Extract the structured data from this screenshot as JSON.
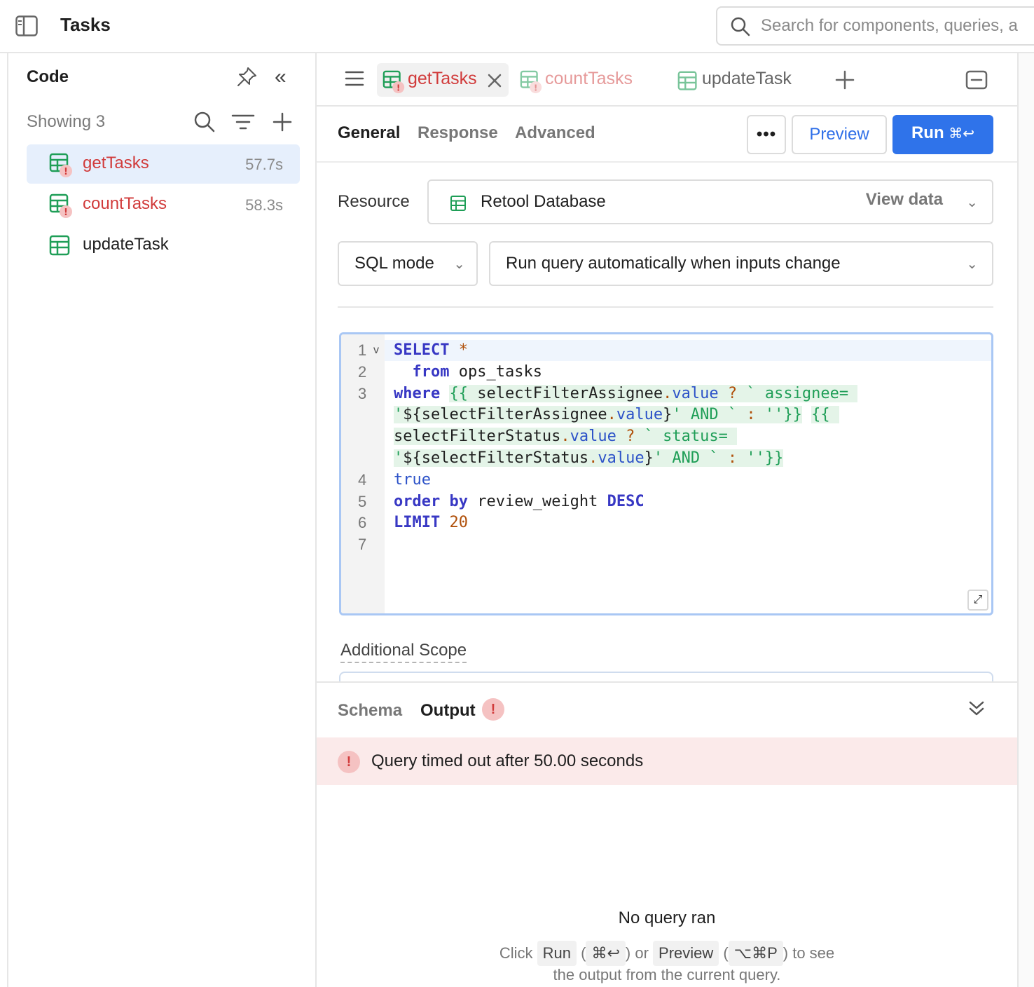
{
  "header": {
    "title": "Tasks",
    "search_placeholder": "Search for components, queries, a"
  },
  "code_panel": {
    "title": "Code",
    "showing": "Showing 3",
    "queries": [
      {
        "name": "getTasks",
        "time": "57.7s",
        "status": "error",
        "active": true
      },
      {
        "name": "countTasks",
        "time": "58.3s",
        "status": "error",
        "active": false
      },
      {
        "name": "updateTask",
        "time": "",
        "status": "ok",
        "active": false
      }
    ]
  },
  "editor_tabs": [
    {
      "label": "getTasks",
      "active": true
    },
    {
      "label": "countTasks",
      "active": false
    },
    {
      "label": "updateTask",
      "active": false
    }
  ],
  "subtabs": {
    "general": "General",
    "response": "Response",
    "advanced": "Advanced"
  },
  "actions": {
    "more": "•••",
    "preview": "Preview",
    "run": "Run",
    "run_shortcut": "⌘↩"
  },
  "resource": {
    "label": "Resource",
    "value": "Retool Database",
    "view_data": "View data"
  },
  "mode": {
    "value": "SQL mode"
  },
  "trigger": {
    "value": "Run query automatically when inputs change"
  },
  "editor": {
    "line_numbers": [
      "1",
      "2",
      "3",
      "4",
      "5",
      "6",
      "7"
    ]
  },
  "additional_scope": "Additional Scope",
  "bottom": {
    "schema_tab": "Schema",
    "output_tab": "Output",
    "error_message": "Query timed out after 50.00 seconds",
    "empty_title": "No query ran",
    "hint_click": "Click",
    "hint_run": "Run",
    "hint_run_kbd": "⌘↩",
    "hint_or": "or",
    "hint_preview": "Preview",
    "hint_preview_kbd": "⌥⌘P",
    "hint_to_see": "to see",
    "hint_line2": "the output from the current query."
  },
  "colors": {
    "accent": "#2f73ea",
    "error": "#d13b3b",
    "error_bg": "#fbeaea",
    "active_row": "#e6effc",
    "table_icon": "#1f9e57"
  }
}
